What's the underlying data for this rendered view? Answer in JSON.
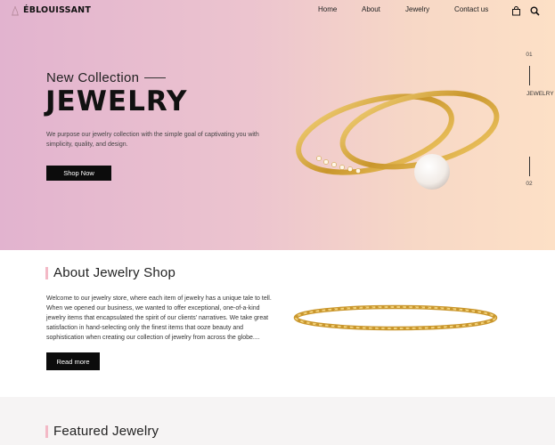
{
  "nav": {
    "logo_text": "ÉBLOUISSANT",
    "links": [
      "Home",
      "About",
      "Jewelry",
      "Contact us"
    ],
    "icons": [
      "shopping-bag-icon",
      "search-icon"
    ]
  },
  "hero": {
    "subtitle": "New Collection",
    "title": "JEWELRY",
    "description": "We purpose our jewelry collection with the simple goal of captivating you with simplicity, quality, and design.",
    "button_label": "Shop Now",
    "pager": {
      "current": "01",
      "total": "02",
      "vertical_label": "JEWELRY"
    }
  },
  "about": {
    "title": "About Jewelry Shop",
    "text": "Welcome to our jewelry store, where each item of jewelry has a unique tale to tell. When we opened our business, we wanted to offer exceptional, one-of-a-kind jewelry items that encapsulated the spirit of our clients' narratives. We take great satisfaction in hand-selecting only the finest items that ooze beauty and sophistication when creating our collection of jewelry from across the globe....",
    "button_label": "Read more"
  },
  "featured": {
    "title": "Featured Jewelry"
  },
  "colors": {
    "accent_bar": "#f3b9c6",
    "gold": "#d4a437",
    "button_bg": "#0c0c0c"
  }
}
